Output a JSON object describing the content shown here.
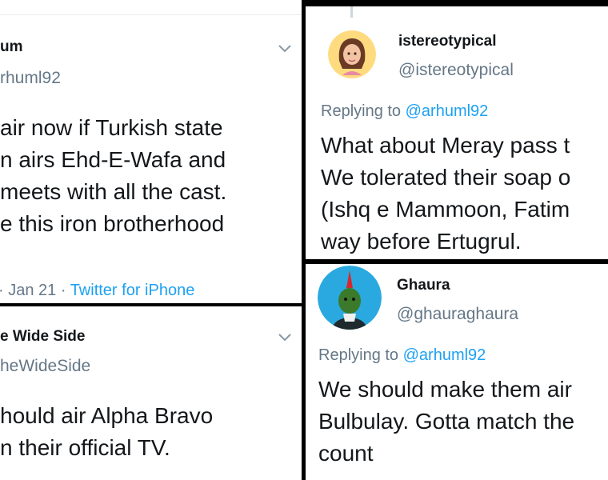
{
  "tweet1": {
    "name": "um",
    "handle": "rhuml92",
    "lines": [
      "air now if Turkish state",
      "n airs Ehd-E-Wafa and",
      " meets with all the cast.",
      "e this iron brotherhood"
    ],
    "date": "· Jan 21 · ",
    "source": "Twitter for iPhone"
  },
  "tweet2": {
    "name": "e Wide Side",
    "handle": "heWideSide",
    "lines": [
      "hould air Alpha Bravo",
      "n their official TV."
    ]
  },
  "tweet3": {
    "name": "istereotypical",
    "handle": "@istereotypical",
    "replying_prefix": "Replying to ",
    "replying_to": "@arhuml92",
    "lines": [
      "What about Meray pass t",
      "We tolerated their soap o",
      "(Ishq e Mammoon, Fatim",
      "way before Ertugrul."
    ]
  },
  "tweet4": {
    "name": "Ghaura",
    "handle": "@ghauraghaura",
    "replying_prefix": "Replying to ",
    "replying_to": "@arhuml92",
    "lines": [
      "We should make them air",
      "Bulbulay. Gotta match the",
      "count"
    ]
  },
  "colors": {
    "link": "#1da1f2",
    "muted": "#657786",
    "text": "#14171a",
    "divider": "#000000"
  },
  "icons": {
    "menu": "chevron-down-icon"
  }
}
